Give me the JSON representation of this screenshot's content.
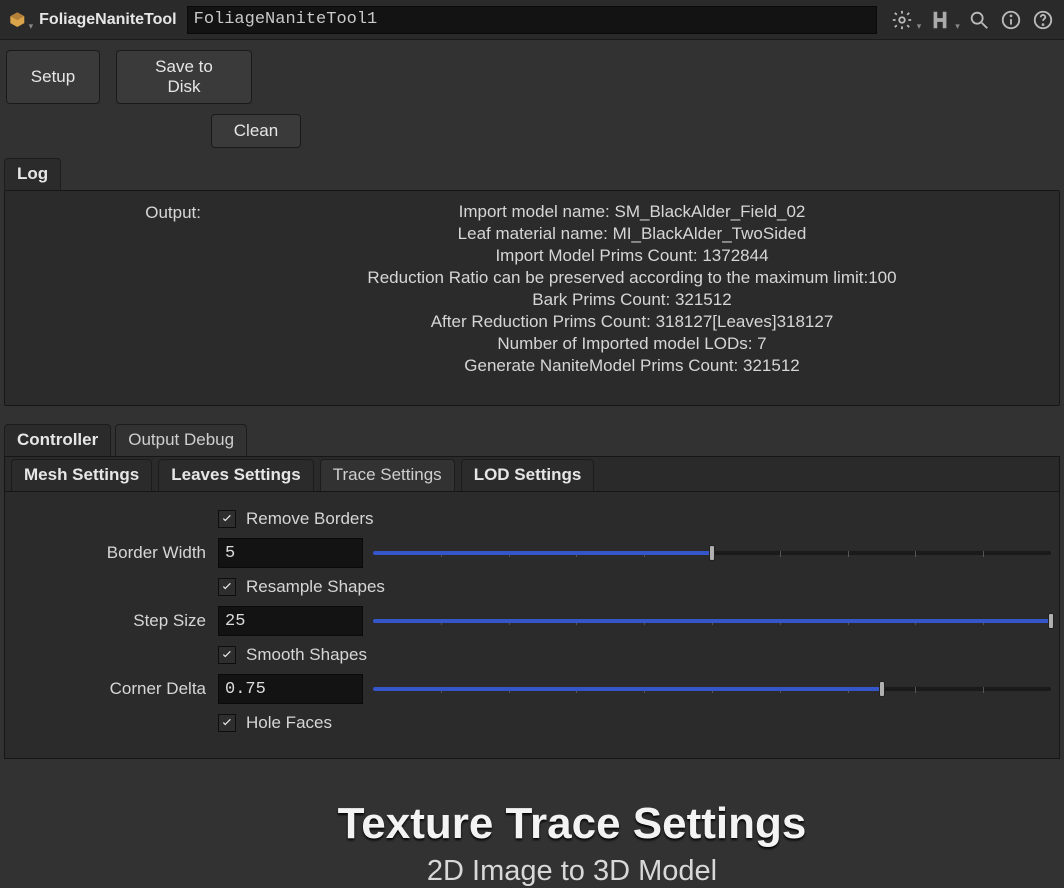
{
  "topbar": {
    "tool_title": "FoliageNaniteTool",
    "node_name": "FoliageNaniteTool1"
  },
  "buttons": {
    "setup": "Setup",
    "save_to_disk": "Save to Disk",
    "clean": "Clean"
  },
  "log": {
    "tab": "Log",
    "output_label": "Output:",
    "lines": [
      "Import model name: SM_BlackAlder_Field_02",
      "Leaf material name: MI_BlackAlder_TwoSided",
      "Import Model Prims Count: 1372844",
      "Reduction Ratio can be preserved according to the maximum limit:100",
      "Bark Prims Count: 321512",
      "After Reduction Prims Count: 318127[Leaves]318127",
      "Number of Imported model LODs: 7",
      " Generate NaniteModel Prims Count: 321512"
    ]
  },
  "tabs_main": {
    "controller": "Controller",
    "output_debug": "Output Debug"
  },
  "tabs_sub": {
    "mesh": "Mesh Settings",
    "leaves": "Leaves Settings",
    "trace": "Trace Settings",
    "lod": "LOD Settings"
  },
  "trace": {
    "remove_borders": {
      "label": "Remove Borders",
      "checked": true
    },
    "border_width": {
      "label": "Border Width",
      "value": "5",
      "fill_pct": 50
    },
    "resample_shapes": {
      "label": "Resample Shapes",
      "checked": true
    },
    "step_size": {
      "label": "Step Size",
      "value": "25",
      "fill_pct": 100
    },
    "smooth_shapes": {
      "label": "Smooth Shapes",
      "checked": true
    },
    "corner_delta": {
      "label": "Corner Delta",
      "value": "0.75",
      "fill_pct": 75
    },
    "hole_faces": {
      "label": "Hole Faces",
      "checked": true
    }
  },
  "hero": {
    "title": "Texture Trace Settings",
    "subtitle": "2D Image to 3D Model"
  }
}
